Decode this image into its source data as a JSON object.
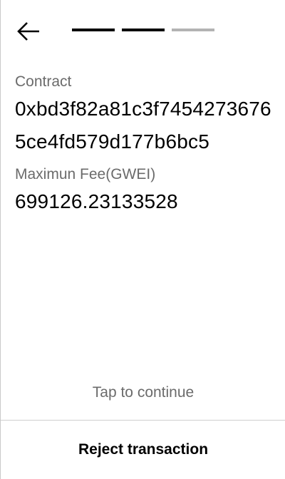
{
  "header": {
    "back_icon": "arrow-left-icon",
    "progress": {
      "total_steps": 3,
      "completed_steps": 2
    }
  },
  "details": {
    "contract_label": "Contract",
    "contract_value": "0xbd3f82a81c3f74542736765ce4fd579d177b6bc5",
    "fee_label": "Maximun Fee(GWEI)",
    "fee_value": "699126.23133528"
  },
  "footer": {
    "tap_hint": "Tap to continue",
    "reject_label": "Reject transaction"
  },
  "colors": {
    "text_primary": "#000000",
    "text_secondary": "#6b6b6b",
    "progress_active": "#000000",
    "progress_inactive": "#b3b3b3",
    "divider": "#cfcfcf"
  }
}
